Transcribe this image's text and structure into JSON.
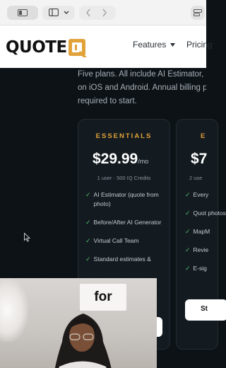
{
  "brand": {
    "name": "QUOTE",
    "accent_color": "#e1a23a"
  },
  "nav": {
    "features": "Features",
    "pricing": "Pricing"
  },
  "intro": [
    "Five plans. All include AI Estimator, B",
    "on iOS and Android. Annual billing pa",
    "required to start."
  ],
  "plans": [
    {
      "name": "ESSENTIALS",
      "price": "$29.99",
      "period": "/mo",
      "meta": "1 user · 500 IQ Credits",
      "features": [
        "AI Estimator (quote from photo)",
        "Before/After AI Generator",
        "Virtual Call Team",
        "Standard estimates &"
      ]
    },
    {
      "name": "E",
      "price": "$7",
      "meta": "2 use",
      "features": [
        "Every",
        "Quot photos",
        "MapM",
        "Revie",
        "E-sig"
      ],
      "cta": "St"
    }
  ],
  "caption": "for"
}
